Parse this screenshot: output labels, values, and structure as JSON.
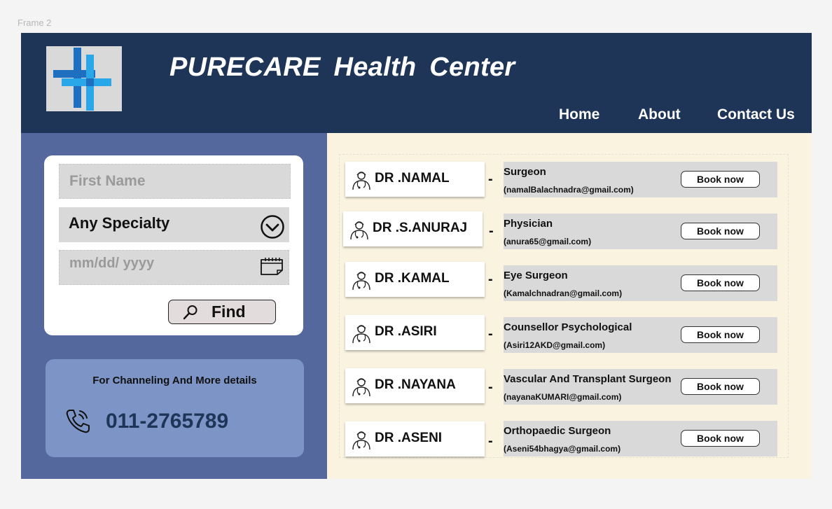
{
  "canvas": {
    "frame_label": "Frame 2"
  },
  "header": {
    "title": "PURECARE  Health  Center",
    "nav": [
      "Home",
      "About",
      "Contact Us"
    ]
  },
  "colors": {
    "header_bg": "#1e3557",
    "sidebar_bg": "#55689e",
    "info_card_bg": "#7d94c6",
    "content_bg": "#faf3e0",
    "logo_blue_dark": "#1f6fc0",
    "logo_blue_light": "#2aa7e8"
  },
  "search": {
    "first_name_placeholder": "First Name",
    "specialty_value": "Any Specialty",
    "date_placeholder": "mm/dd/ yyyy",
    "find_label": "Find",
    "icons": [
      "chevron-down-icon",
      "calendar-icon",
      "search-icon"
    ]
  },
  "contact": {
    "text": "For  Channeling And More details",
    "phone": "011-2765789",
    "icon": "phone-icon"
  },
  "doctors": [
    {
      "name": "DR .NAMAL",
      "dash": "-",
      "specialty": "Surgeon",
      "email": "(namalBalachnadra@gmail.com)",
      "book": "Book now"
    },
    {
      "name": "DR .S.ANURAJ",
      "dash": "-",
      "specialty": "Physician",
      "email": "(anura65@gmail.com)",
      "book": "Book now"
    },
    {
      "name": "DR .KAMAL",
      "dash": "-",
      "specialty": "Eye Surgeon",
      "email": "(Kamalchnadran@gmail.com)",
      "book": "Book now"
    },
    {
      "name": "DR .ASIRI",
      "dash": "-",
      "specialty": "Counsellor Psychological",
      "email": "(Asiri12AKD@gmail.com)",
      "book": "Book now"
    },
    {
      "name": "DR .NAYANA",
      "dash": "-",
      "specialty": "Vascular And Transplant Surgeon",
      "email": "(nayanaKUMARI@gmail.com)",
      "book": "Book now"
    },
    {
      "name": "DR .ASENI",
      "dash": "-",
      "specialty": "Orthopaedic Surgeon",
      "email": "(Aseni54bhagya@gmail.com)",
      "book": "Book now"
    }
  ]
}
